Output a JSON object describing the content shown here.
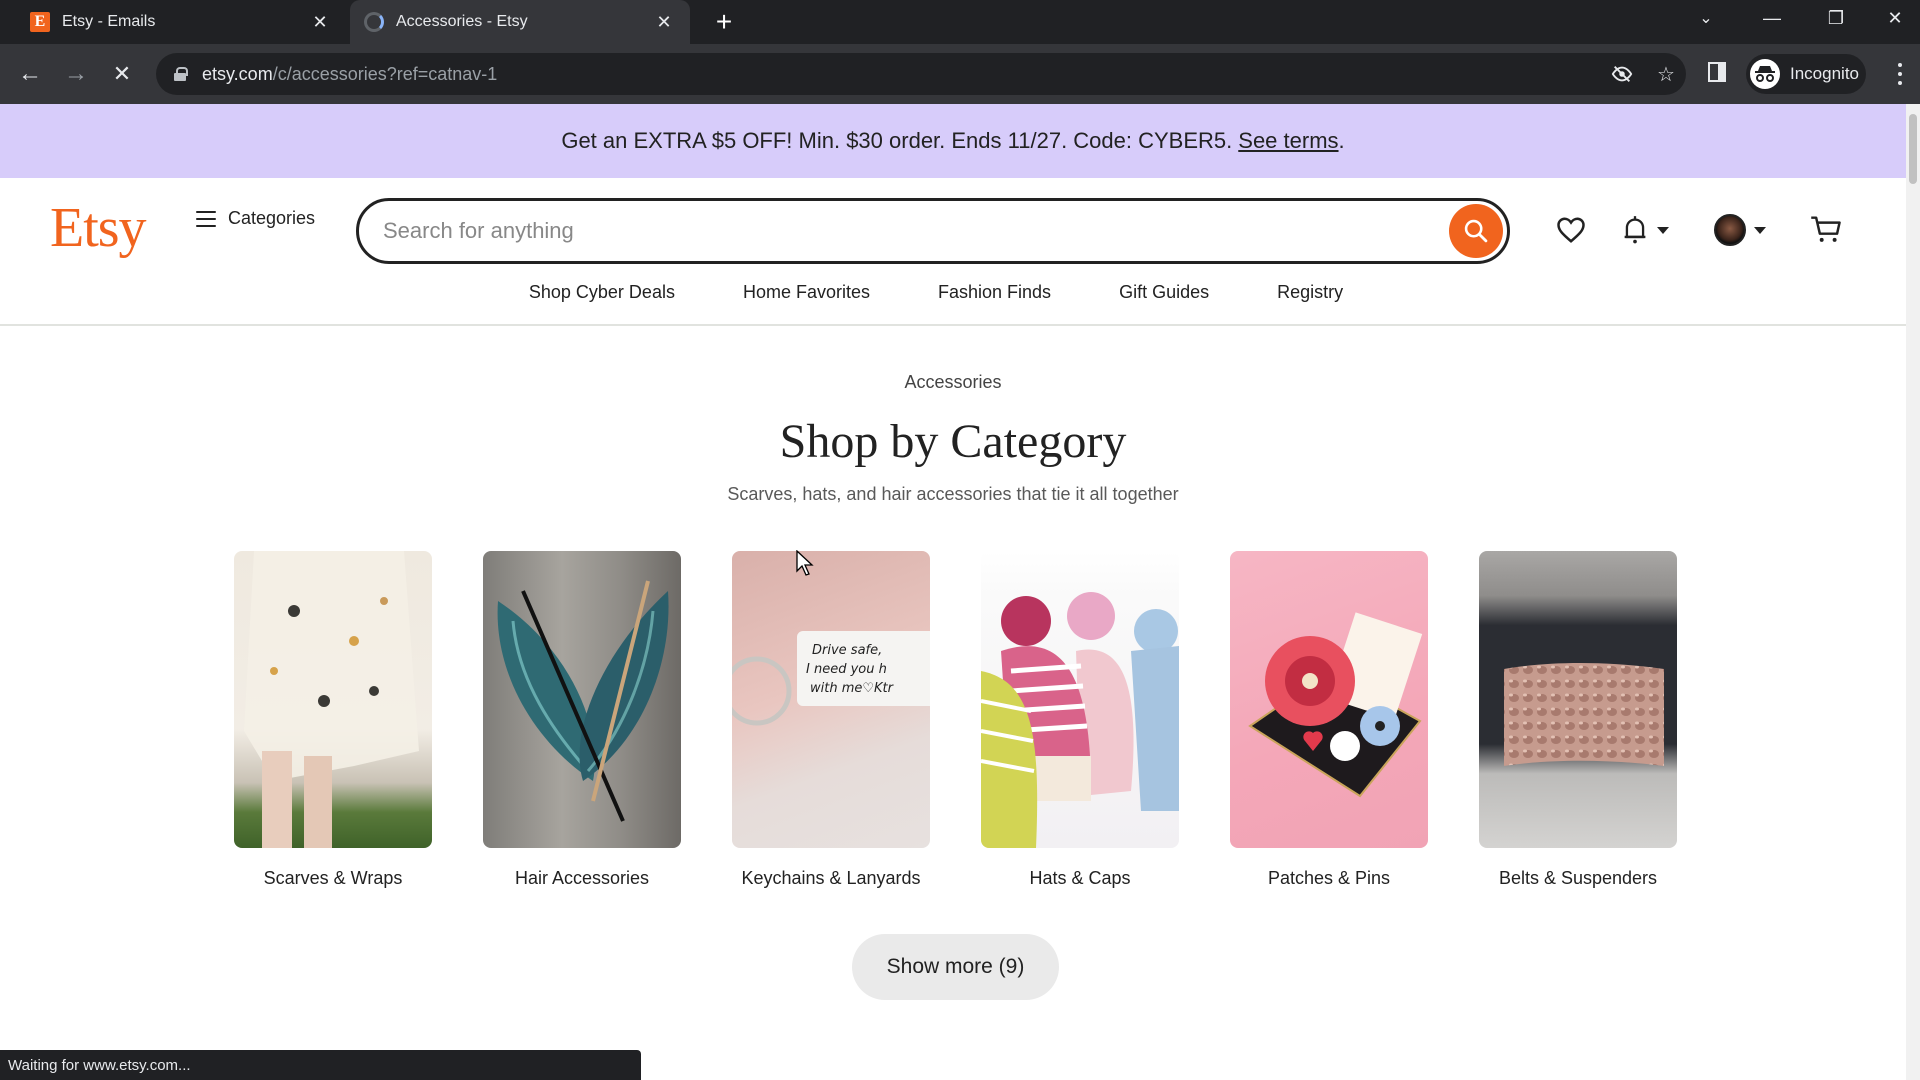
{
  "browser": {
    "tabs": [
      {
        "title": "Etsy - Emails",
        "favicon": "etsy-favicon",
        "active": false
      },
      {
        "title": "Accessories - Etsy",
        "favicon": "loading-spinner",
        "active": true
      }
    ],
    "url_host": "etsy.com",
    "url_path": "/c/accessories?ref=catnav-1",
    "profile_label": "Incognito",
    "status_text": "Waiting for www.etsy.com..."
  },
  "promo": {
    "text": "Get an EXTRA $5 OFF! Min. $30 order. Ends 11/27. Code: CYBER5.",
    "link": "See terms",
    "trailing": ".",
    "background": "#d7ccfa"
  },
  "header": {
    "logo": "Etsy",
    "categories_label": "Categories",
    "search_placeholder": "Search for anything",
    "brand_color": "#f1641e"
  },
  "subnav": [
    "Shop Cyber Deals",
    "Home Favorites",
    "Fashion Finds",
    "Gift Guides",
    "Registry"
  ],
  "main": {
    "breadcrumb": "Accessories",
    "title": "Shop by Category",
    "subtitle": "Scarves, hats, and hair accessories that tie it all together",
    "categories": [
      {
        "label": "Scarves & Wraps"
      },
      {
        "label": "Hair Accessories"
      },
      {
        "label": "Keychains & Lanyards"
      },
      {
        "label": "Hats & Caps"
      },
      {
        "label": "Patches & Pins"
      },
      {
        "label": "Belts & Suspenders"
      }
    ],
    "show_more_label": "Show more (9)"
  },
  "keychain_text": "Drive safe, I need you with me♡Ktr"
}
